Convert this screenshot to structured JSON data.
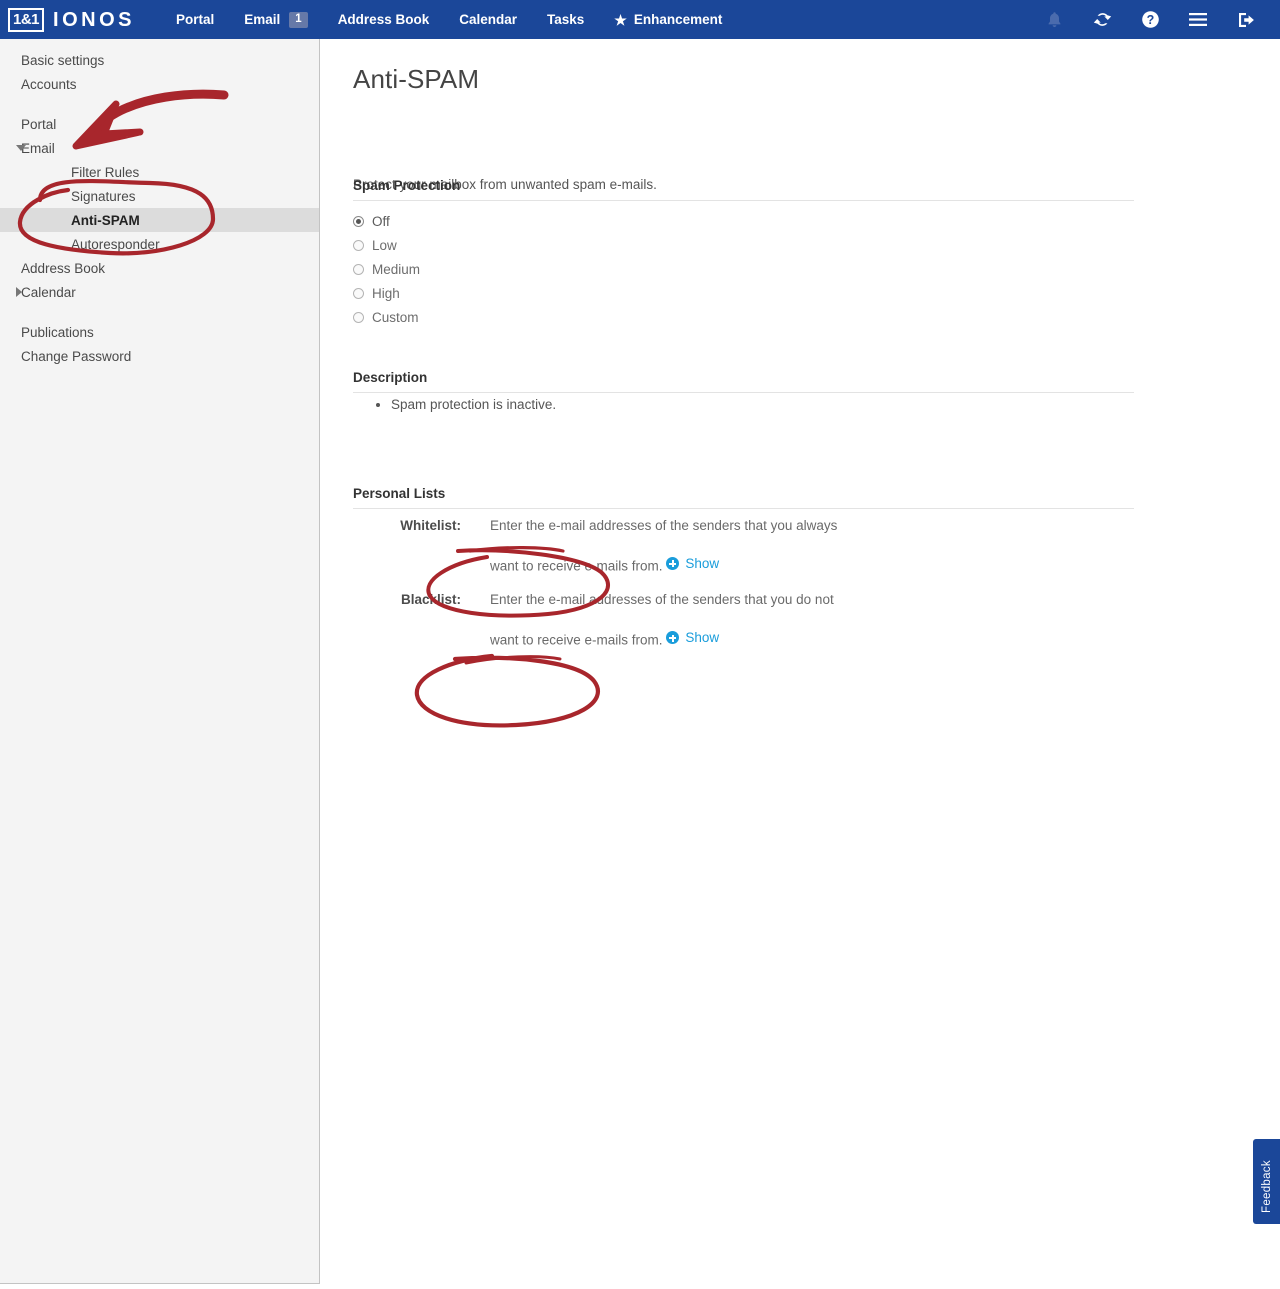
{
  "navbar": {
    "logo_mark": "1&1",
    "logo_word": "IONOS",
    "items": [
      {
        "label": "Portal"
      },
      {
        "label": "Email",
        "badge": "1"
      },
      {
        "label": "Address Book"
      },
      {
        "label": "Calendar"
      },
      {
        "label": "Tasks"
      },
      {
        "label": "Enhancement",
        "icon": "star-icon"
      }
    ],
    "icons": [
      {
        "name": "bell-icon",
        "title": "Notifications"
      },
      {
        "name": "refresh-icon",
        "title": "Refresh"
      },
      {
        "name": "help-icon",
        "title": "Help"
      },
      {
        "name": "hamburger-menu-icon",
        "title": "Menu"
      },
      {
        "name": "logout-icon",
        "title": "Log out"
      }
    ],
    "background_color": "#1b4799",
    "badge_color": "#6679a8"
  },
  "sidebar": {
    "items": [
      {
        "label": "Basic settings",
        "level": 0,
        "state": "none"
      },
      {
        "label": "Accounts",
        "level": 0,
        "state": "none"
      },
      {
        "label": "Portal",
        "level": 0,
        "state": "none"
      },
      {
        "label": "Email",
        "level": 0,
        "state": "expanded"
      },
      {
        "label": "Filter Rules",
        "level": 1,
        "state": "none"
      },
      {
        "label": "Signatures",
        "level": 1,
        "state": "none"
      },
      {
        "label": "Anti-SPAM",
        "level": 1,
        "state": "active"
      },
      {
        "label": "Autoresponder",
        "level": 1,
        "state": "none"
      },
      {
        "label": "Address Book",
        "level": 0,
        "state": "none"
      },
      {
        "label": "Calendar",
        "level": 0,
        "state": "collapsed"
      },
      {
        "label": "Publications",
        "level": 0,
        "state": "none"
      },
      {
        "label": "Change Password",
        "level": 0,
        "state": "none"
      }
    ]
  },
  "main": {
    "title": "Anti-SPAM",
    "intro": "Protect your mailbox from unwanted spam e-mails.",
    "spam_protection": {
      "heading": "Spam Protection",
      "selected": "Off",
      "options": [
        {
          "label": "Off",
          "selected": true
        },
        {
          "label": "Low",
          "selected": false
        },
        {
          "label": "Medium",
          "selected": false
        },
        {
          "label": "High",
          "selected": false
        },
        {
          "label": "Custom",
          "selected": false
        }
      ]
    },
    "description": {
      "heading": "Description",
      "bullets": [
        "Spam protection is inactive."
      ]
    },
    "personal_lists": {
      "heading": "Personal Lists",
      "entries": [
        {
          "label": "Whitelist:",
          "text": "Enter the e-mail addresses of the senders that you always want to receive e-mails from.",
          "action_label": "Show",
          "action_icon": "plus-circle-icon"
        },
        {
          "label": "Blacklist:",
          "text": "Enter the e-mail addresses of the senders that you do not want to receive e-mails from.",
          "action_label": "Show",
          "action_icon": "plus-circle-icon"
        }
      ]
    }
  },
  "feedback_tab": {
    "label": "Feedback"
  },
  "annotations": {
    "color": "#a8262c",
    "marks": [
      {
        "name": "arrow-to-email-sidebar-item",
        "type": "curved-arrow"
      },
      {
        "name": "ellipse-around-email-submenu",
        "type": "ellipse"
      },
      {
        "name": "ellipse-around-whitelist-show",
        "type": "ellipse"
      },
      {
        "name": "ellipse-around-blacklist-show",
        "type": "ellipse"
      }
    ]
  }
}
